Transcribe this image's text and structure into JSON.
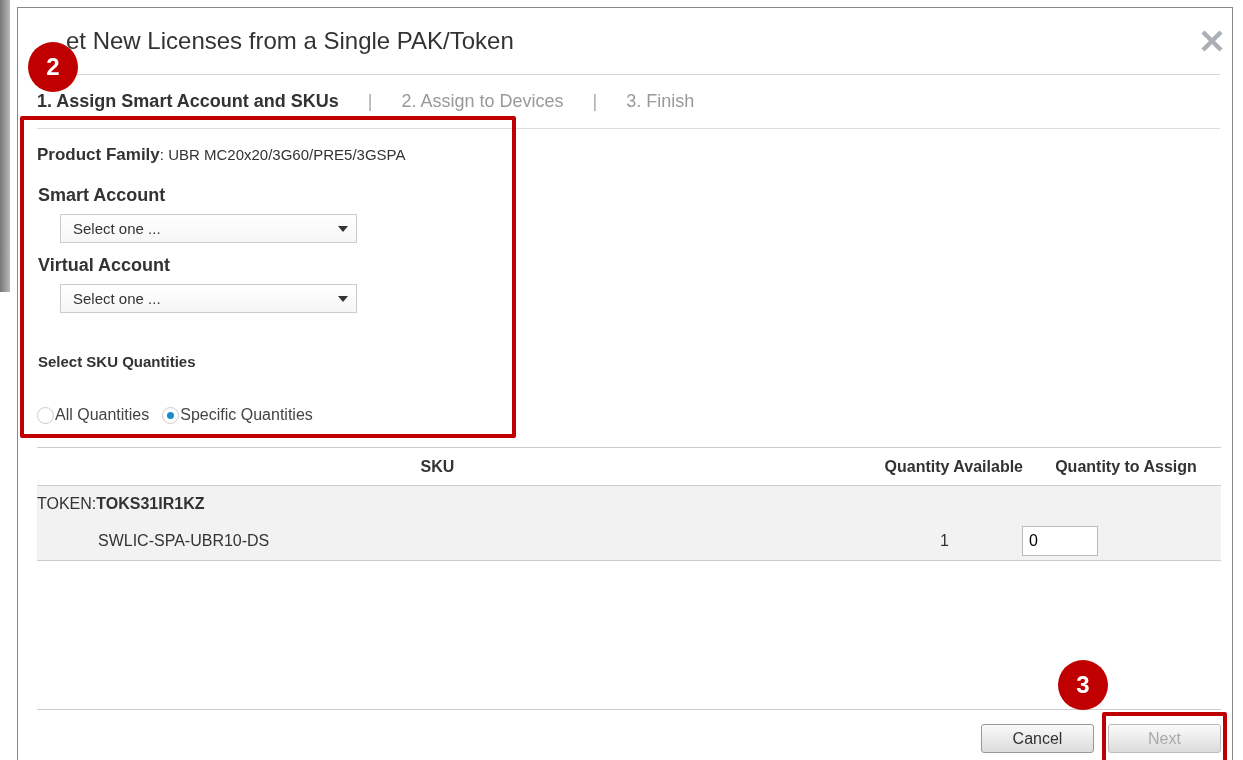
{
  "dialog": {
    "title": "et New Licenses from a Single PAK/Token"
  },
  "step_separators": [
    "|",
    "|"
  ],
  "steps": [
    {
      "label": "1. Assign Smart Account and SKUs",
      "selected": true
    },
    {
      "label": "2. Assign to Devices",
      "selected": false
    },
    {
      "label": "3. Finish",
      "selected": false
    }
  ],
  "form": {
    "highlighted": true,
    "product_family": "**Product Family**: UBR MC20x20/3G60/PRE5/3GSPA",
    "fields": [
      {
        "label": "Smart Account",
        "placeholder": "Select one ..."
      },
      {
        "label": "Virtual Account",
        "placeholder": "Select one ..."
      }
    ],
    "sku_quantities": {
      "label": "Select SKU Quantities",
      "options": [
        {
          "label": "All Quantities",
          "selected": false
        },
        {
          "label": "Specific Quantities",
          "selected": true
        }
      ]
    }
  },
  "table": {
    "columns": [
      "SKU",
      "Quantity Available",
      "Quantity to Assign"
    ],
    "groups": [
      {
        "label": "TOKEN:**TOKS31IR1KZ**",
        "rows": [
          {
            "sku": "SWLIC-SPA-UBR10-DS",
            "available": "1",
            "assign": "0"
          }
        ]
      }
    ]
  },
  "buttons": [
    {
      "label": "Cancel",
      "disabled": false,
      "highlighted": false
    },
    {
      "label": "Next",
      "disabled": true,
      "highlighted": true
    }
  ],
  "callouts": [
    {
      "label": "2"
    },
    {
      "label": "3"
    }
  ]
}
